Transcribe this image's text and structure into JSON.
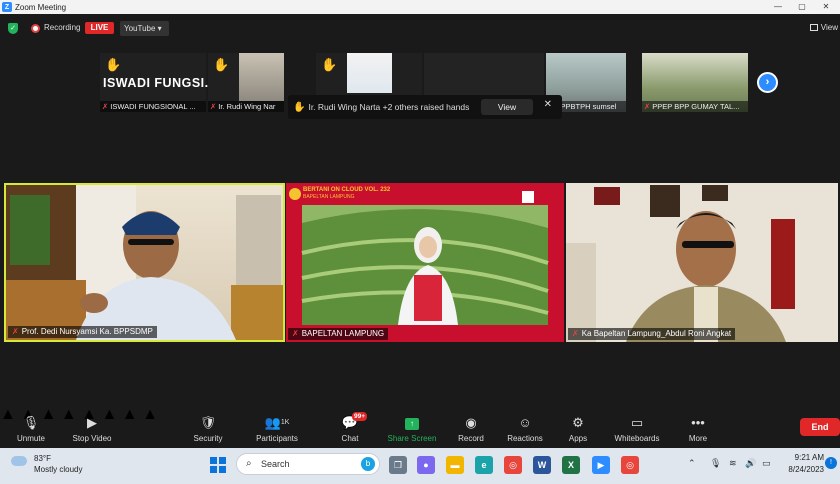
{
  "window": {
    "title": "Zoom Meeting",
    "controls": [
      "—",
      "▢",
      "✕"
    ]
  },
  "topbar": {
    "recording_label": "Recording",
    "live_label": "LIVE",
    "stream_label": "YouTube ▾",
    "view_label": "View"
  },
  "thumbnails": [
    {
      "label": "ISWADI FUNGSIONAL ...",
      "big_name": "ISWADI  FUNGSI...",
      "hand": "✋",
      "muted": true
    },
    {
      "label": "Ir. Rudi Wing Nar",
      "hand": "✋",
      "muted": true
    },
    {
      "label": "",
      "hand": "✋",
      "muted": false
    },
    {
      "label": "",
      "hand": "",
      "muted": false
    },
    {
      "label": "D BPPBTPH sumsel",
      "hand": "",
      "muted": false
    },
    {
      "label": "PPEP BPP GUMAY TAL...",
      "hand": "",
      "muted": true
    }
  ],
  "raise_toast": {
    "text": "Ir. Rudi Wing Narta +2 others raised hands",
    "view_label": "View",
    "close_label": "✕"
  },
  "next_page_icon": "›",
  "gallery": [
    {
      "name": "Prof. Dedi Nursyamsi Ka. BPPSDMP",
      "muted": true
    },
    {
      "name": "BAPELTAN LAMPUNG",
      "muted": true,
      "banner_title": "BERTANI ON CLOUD VOL. 232",
      "banner_sub": "BAPELTAN LAMPUNG"
    },
    {
      "name": "Ka Bapeltan Lampung_Abdul Roni Angkat",
      "muted": true
    }
  ],
  "toolbar": [
    {
      "label": "Unmute",
      "icon": "mic-off-icon"
    },
    {
      "label": "Stop Video",
      "icon": "video-icon"
    },
    {
      "label": "Security",
      "icon": "shield-icon"
    },
    {
      "label": "Participants",
      "icon": "participants-icon",
      "count": "1K"
    },
    {
      "label": "Chat",
      "icon": "chat-icon",
      "badge": "99+"
    },
    {
      "label": "Share Screen",
      "icon": "share-screen-icon"
    },
    {
      "label": "Record",
      "icon": "record-icon"
    },
    {
      "label": "Reactions",
      "icon": "reactions-icon"
    },
    {
      "label": "Apps",
      "icon": "apps-icon"
    },
    {
      "label": "Whiteboards",
      "icon": "whiteboard-icon"
    },
    {
      "label": "More",
      "icon": "more-icon"
    }
  ],
  "end_label": "End",
  "taskbar": {
    "weather_temp": "83°F",
    "weather_desc": "Mostly cloudy",
    "search_placeholder": "Search",
    "time": "9:21 AM",
    "date": "8/24/2023"
  },
  "colors": {
    "zoom_blue": "#2d8cff",
    "live_red": "#e02828",
    "share_green": "#23b35c",
    "active_speaker": "#d6e83a"
  }
}
